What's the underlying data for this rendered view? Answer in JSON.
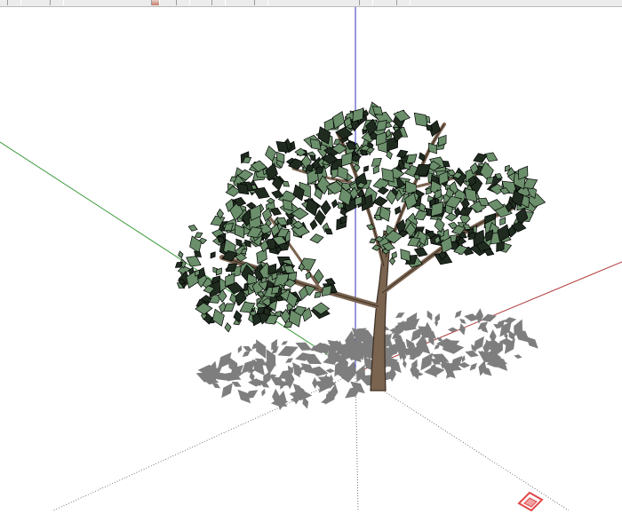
{
  "app": {
    "window_title": "",
    "toolbar": {
      "visible": true,
      "buttons": [
        "tool-1",
        "tool-2",
        "tool-3",
        "tool-4",
        "tool-5",
        "tool-6",
        "tool-7",
        "tool-8"
      ]
    }
  },
  "scene": {
    "object": "tree model",
    "axes": {
      "red": "#b03a3a",
      "green": "#3a9a3a",
      "blue": "#3030b8"
    },
    "colors": {
      "trunk": "#7a6450",
      "trunk_edge": "#3a2d22",
      "leaf": "#6b8f6b",
      "leaf_dark": "#2f4a2f",
      "shadow": "#7e7e7e",
      "background": "#ffffff"
    }
  },
  "icons": {
    "logo": "watermark-logo-icon"
  }
}
